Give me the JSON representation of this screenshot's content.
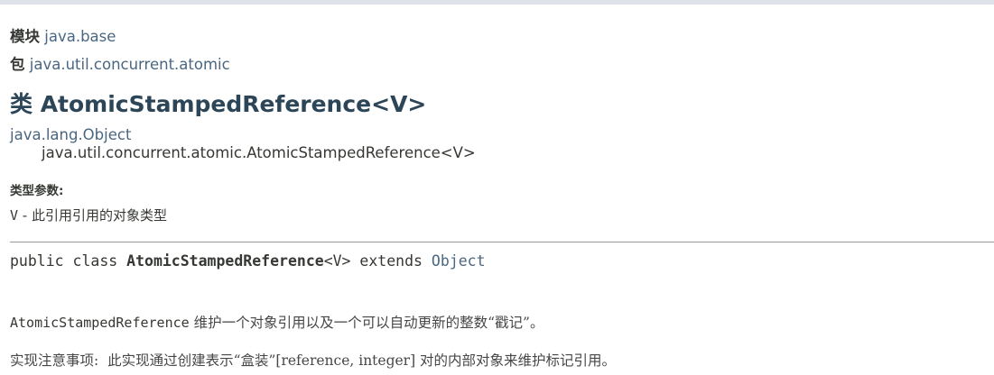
{
  "module": {
    "label": "模块",
    "name": "java.base"
  },
  "package": {
    "label": "包",
    "name": "java.util.concurrent.atomic"
  },
  "class_title": "类 AtomicStampedReference<V>",
  "inheritance": {
    "root": "java.lang.Object",
    "child": "java.util.concurrent.atomic.AtomicStampedReference<V>"
  },
  "type_params": {
    "heading": "类型参数:",
    "name": "V",
    "description": " - 此引用引用的对象类型"
  },
  "signature": {
    "modifiers": "public class ",
    "class_name": "AtomicStampedReference",
    "type_param": "<V>",
    "extends_kw": " extends ",
    "superclass": "Object"
  },
  "description": {
    "code": "AtomicStampedReference",
    "text": " 维护一个对象引用以及一个可以自动更新的整数“戳记”。"
  },
  "impl_note": "实现注意事项:  此实现通过创建表示“盒装”[reference, integer] 对的内部对象来维护标记引用。",
  "colors": {
    "link": "#4a6782",
    "title": "#2c4557",
    "top_bar": "#dee3e9",
    "text": "#353833"
  }
}
